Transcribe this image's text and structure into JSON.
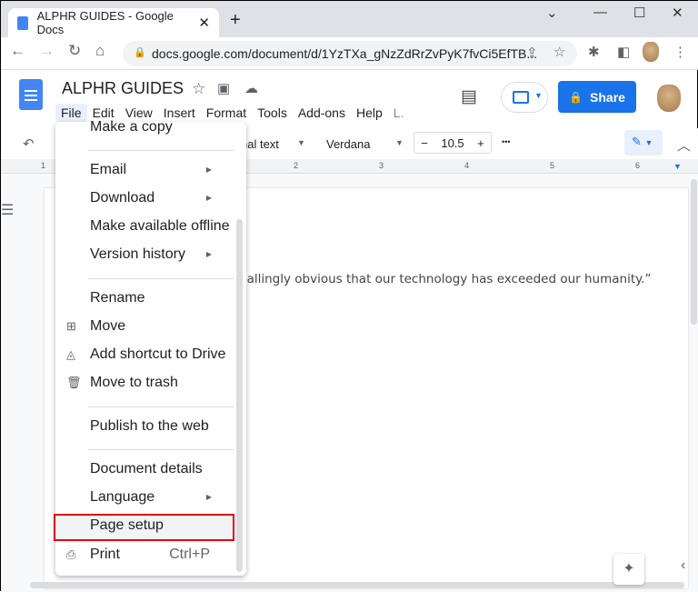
{
  "browser": {
    "tab_title": "ALPHR GUIDES - Google Docs",
    "url": "docs.google.com/document/d/1YzTXa_gNzZdRrZvPyK7fvCi5EfTB..."
  },
  "doc": {
    "title": "ALPHR GUIDES",
    "menus": [
      "File",
      "Edit",
      "View",
      "Insert",
      "Format",
      "Tools",
      "Add-ons",
      "Help",
      "L."
    ],
    "share_label": "Share",
    "accent": "#1a73e8"
  },
  "toolbar": {
    "style": "nal text",
    "font": "Verdana",
    "size": "10.5",
    "minus": "−",
    "plus": "+",
    "more": "•••"
  },
  "ruler": [
    "1",
    "2",
    "3",
    "4",
    "5",
    "6"
  ],
  "body_text": "pallingly obvious that our technology has exceeded our humanity.”",
  "file_menu": {
    "items": [
      {
        "label": "Make a copy"
      },
      {
        "label": "Email",
        "submenu": true
      },
      {
        "label": "Download",
        "submenu": true
      },
      {
        "label": "Make available offline"
      },
      {
        "label": "Version history",
        "submenu": true
      },
      {
        "label": "Rename"
      },
      {
        "label": "Move",
        "icon": "folder-move-icon"
      },
      {
        "label": "Add shortcut to Drive",
        "icon": "drive-shortcut-icon"
      },
      {
        "label": "Move to trash",
        "icon": "trash-icon"
      },
      {
        "label": "Publish to the web"
      },
      {
        "label": "Document details"
      },
      {
        "label": "Language",
        "submenu": true
      },
      {
        "label": "Page setup",
        "highlighted": true
      },
      {
        "label": "Print",
        "icon": "print-icon",
        "shortcut": "Ctrl+P"
      }
    ],
    "highlight_color": "#e3000f"
  }
}
